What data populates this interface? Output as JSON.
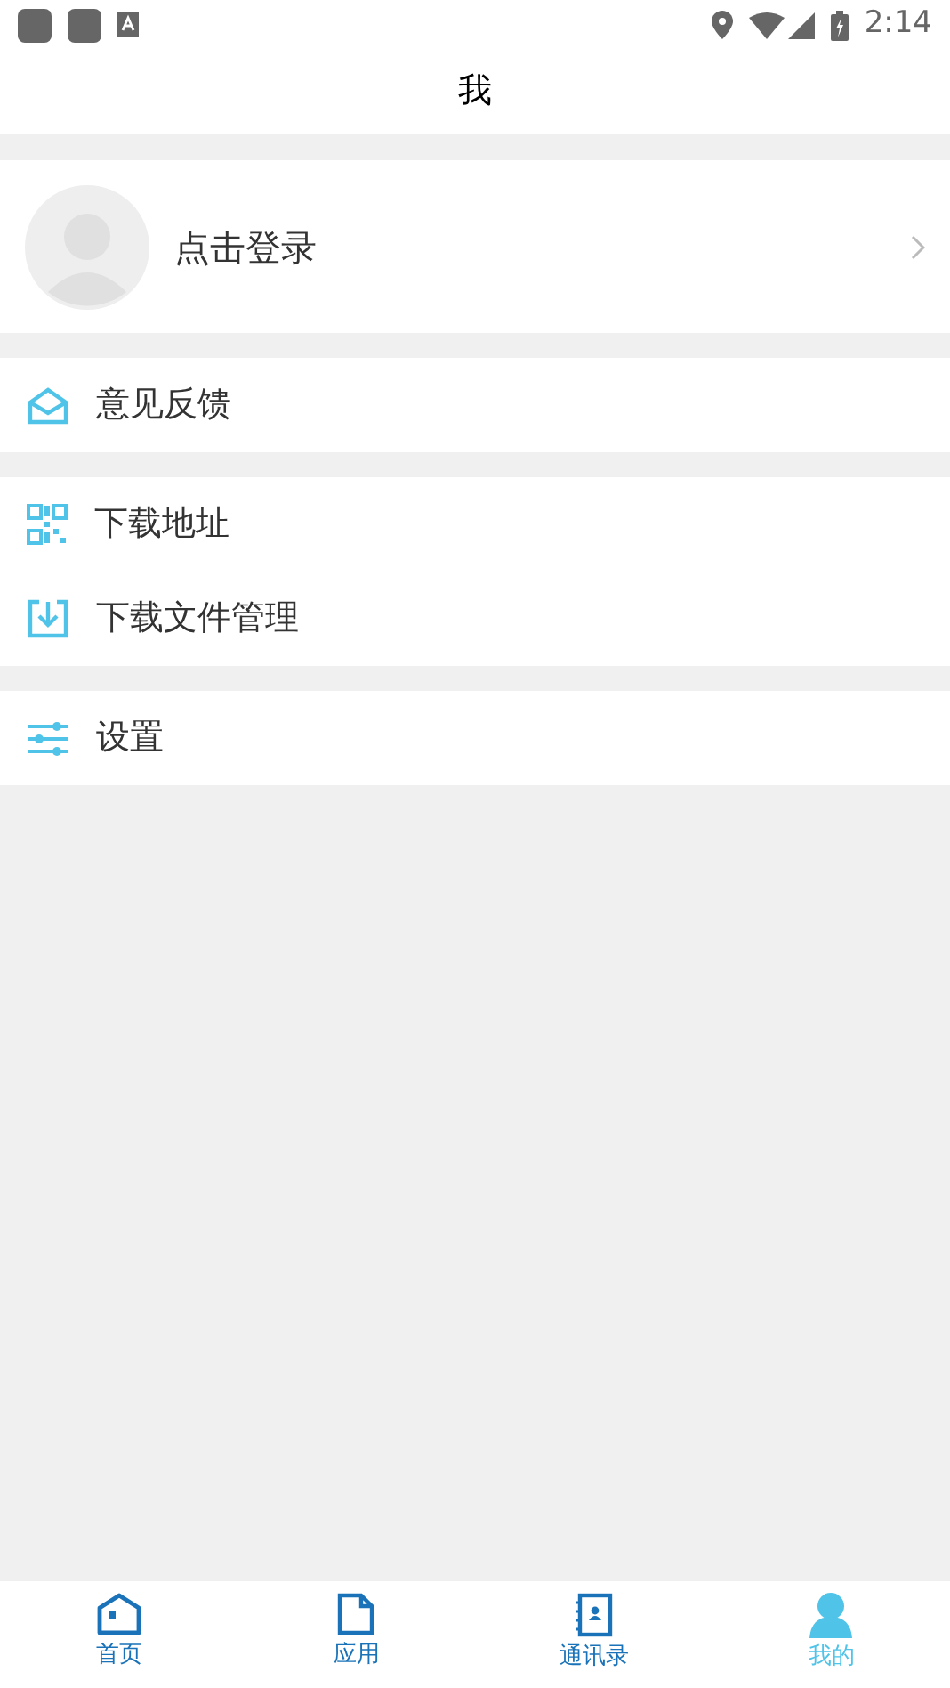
{
  "status_bar": {
    "time": "2:14"
  },
  "header": {
    "title": "我"
  },
  "profile": {
    "label": "点击登录"
  },
  "menu_groups": [
    {
      "items": [
        {
          "kind": "mail",
          "label": "意见反馈"
        }
      ]
    },
    {
      "items": [
        {
          "kind": "qr",
          "label": "下载地址"
        },
        {
          "kind": "download",
          "label": "下载文件管理"
        }
      ]
    },
    {
      "items": [
        {
          "kind": "sliders",
          "label": "设置"
        }
      ]
    }
  ],
  "tabs": [
    {
      "kind": "home",
      "label": "首页",
      "selected": false
    },
    {
      "kind": "file",
      "label": "应用",
      "selected": false
    },
    {
      "kind": "contacts",
      "label": "通讯录",
      "selected": false
    },
    {
      "kind": "person",
      "label": "我的",
      "selected": true
    }
  ]
}
